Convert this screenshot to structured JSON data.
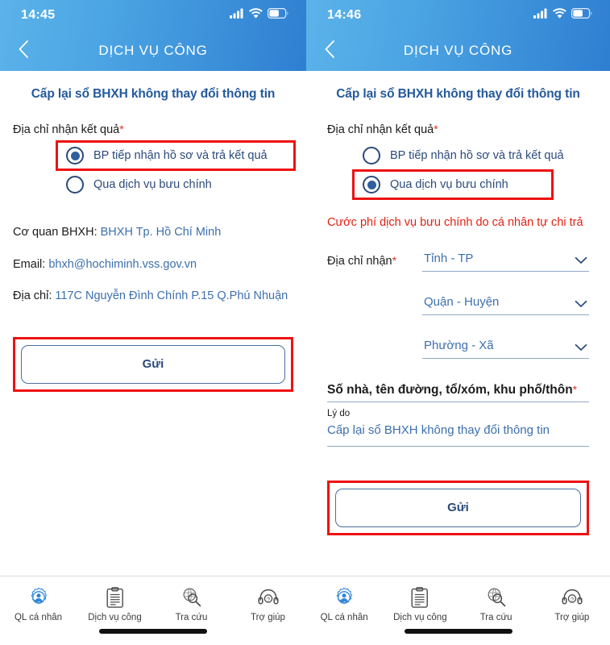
{
  "left": {
    "status": {
      "time": "14:45",
      "signal_icon": "signal-bars-icon",
      "wifi_icon": "wifi-icon",
      "battery_icon": "battery-icon"
    },
    "nav": {
      "back_icon": "chevron-left-icon",
      "title": "DỊCH VỤ CÔNG"
    },
    "page_title": "Cấp lại sổ BHXH không thay đổi thông tin",
    "address_label": "Địa chỉ nhận kết quả",
    "required_mark": "*",
    "radios": [
      {
        "label": "BP tiếp nhận hồ sơ và trả kết quả",
        "selected": true,
        "highlighted": true
      },
      {
        "label": "Qua dịch vụ bưu chính",
        "selected": false,
        "highlighted": false
      }
    ],
    "info": [
      {
        "key": "Cơ quan BHXH:",
        "value": "BHXH Tp. Hồ Chí Minh"
      },
      {
        "key": "Email:",
        "value": "bhxh@hochiminh.vss.gov.vn"
      },
      {
        "key": "Địa chỉ:",
        "value": "117C Nguyễn Đình Chính P.15 Q.Phú Nhuận"
      }
    ],
    "submit_label": "Gửi"
  },
  "right": {
    "status": {
      "time": "14:46",
      "signal_icon": "signal-bars-icon",
      "wifi_icon": "wifi-icon",
      "battery_icon": "battery-icon"
    },
    "nav": {
      "back_icon": "chevron-left-icon",
      "title": "DỊCH VỤ CÔNG"
    },
    "page_title": "Cấp lại sổ BHXH không thay đổi thông tin",
    "address_label": "Địa chỉ nhận kết quả",
    "required_mark": "*",
    "radios": [
      {
        "label": "BP tiếp nhận hồ sơ và trả kết quả",
        "selected": false,
        "highlighted": false
      },
      {
        "label": "Qua dịch vụ bưu chính",
        "selected": true,
        "highlighted": true
      }
    ],
    "warning": "Cước phí dịch vụ bưu chính do cá nhân tự chi trả",
    "receive_address_label": "Địa chỉ nhận",
    "selects": [
      {
        "value": "Tỉnh - TP",
        "chevron_icon": "chevron-down-icon"
      },
      {
        "value": "Quận - Huyện",
        "chevron_icon": "chevron-down-icon"
      },
      {
        "value": "Phường - Xã",
        "chevron_icon": "chevron-down-icon"
      }
    ],
    "street_placeholder": "Số nhà, tên đường, tổ/xóm, khu phố/thôn",
    "reason_label": "Lý do",
    "reason_value": "Cấp lại sổ BHXH không thay đổi  thông tin",
    "submit_label": "Gửi"
  },
  "tabbar": {
    "items": [
      {
        "label": "QL cá nhân",
        "icon": "person-gear-icon",
        "active": true
      },
      {
        "label": "Dịch vụ công",
        "icon": "clipboard-document-icon",
        "active": false
      },
      {
        "label": "Tra cứu",
        "icon": "globe-magnifier-icon",
        "active": false
      },
      {
        "label": "Trợ giúp",
        "icon": "headset-help-icon",
        "active": false
      }
    ]
  },
  "colors": {
    "header_light": "#5cb3ea",
    "header_dark": "#2f7fd1",
    "title_blue": "#24599c",
    "link_blue": "#3d6fad",
    "radio_navy": "#2a4a7a",
    "highlight_red": "#ee1111",
    "warning_red": "#e22113"
  }
}
